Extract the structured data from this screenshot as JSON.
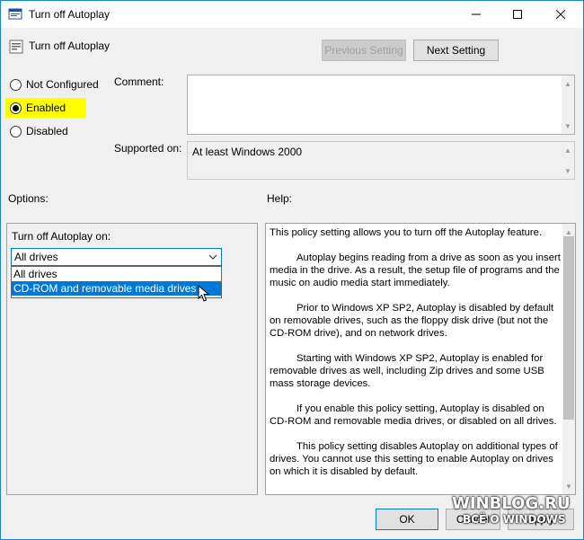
{
  "window": {
    "title": "Turn off Autoplay"
  },
  "header": {
    "policy_name": "Turn off Autoplay",
    "prev_label": "Previous Setting",
    "next_label": "Next Setting"
  },
  "state": {
    "options": [
      "Not Configured",
      "Enabled",
      "Disabled"
    ],
    "selected": "Enabled"
  },
  "comment": {
    "label": "Comment:",
    "value": ""
  },
  "supported": {
    "label": "Supported on:",
    "value": "At least Windows 2000"
  },
  "options_section": {
    "label": "Options:",
    "field_label": "Turn off Autoplay on:",
    "selected_value": "All drives",
    "dropdown_items": [
      "All drives",
      "CD-ROM and removable media drives"
    ]
  },
  "help": {
    "label": "Help:",
    "paragraphs": [
      "This policy setting allows you to turn off the Autoplay feature.",
      "Autoplay begins reading from a drive as soon as you insert media in the drive. As a result, the setup file of programs and the music on audio media start immediately.",
      "Prior to Windows XP SP2, Autoplay is disabled by default on removable drives, such as the floppy disk drive (but not the CD-ROM drive), and on network drives.",
      "Starting with Windows XP SP2, Autoplay is enabled for removable drives as well, including Zip drives and some USB mass storage devices.",
      "If you enable this policy setting, Autoplay is disabled on CD-ROM and removable media drives, or disabled on all drives.",
      "This policy setting disables Autoplay on additional types of drives. You cannot use this setting to enable Autoplay on drives on which it is disabled by default."
    ]
  },
  "buttons": {
    "ok": "OK",
    "cancel": "Cancel",
    "apply": "Apply"
  },
  "watermark": {
    "main": "WINBLOG.RU",
    "sub": "ВСЁ О WINDOWS"
  },
  "colors": {
    "accent": "#0078d7",
    "highlight": "#ffff00",
    "border": "#1883d7"
  }
}
